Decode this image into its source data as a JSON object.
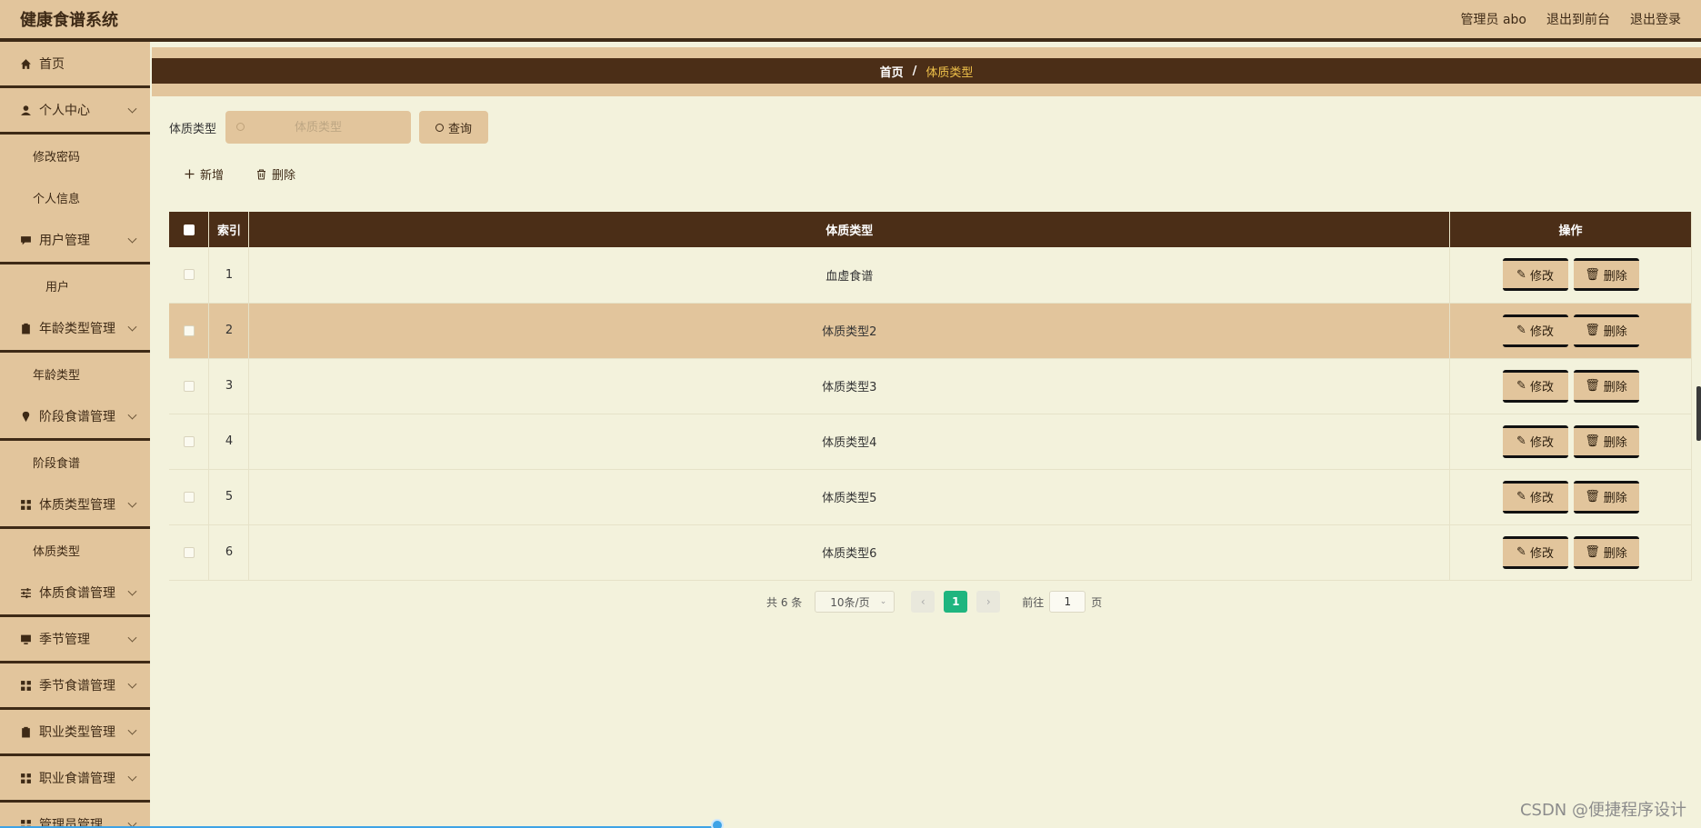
{
  "header": {
    "title": "健康食谱系统",
    "user": "管理员 abo",
    "front": "退出到前台",
    "logout": "退出登录"
  },
  "sidebar": {
    "items": [
      {
        "label": "首页",
        "icon": "home-icon"
      },
      {
        "label": "个人中心",
        "icon": "user-icon"
      },
      {
        "label": "修改密码"
      },
      {
        "label": "个人信息"
      },
      {
        "label": "用户管理",
        "icon": "chat-icon"
      },
      {
        "label": "用户"
      },
      {
        "label": "年龄类型管理",
        "icon": "clipboard-icon"
      },
      {
        "label": "年龄类型"
      },
      {
        "label": "阶段食谱管理",
        "icon": "pin-icon"
      },
      {
        "label": "阶段食谱"
      },
      {
        "label": "体质类型管理",
        "icon": "grid-icon"
      },
      {
        "label": "体质类型"
      },
      {
        "label": "体质食谱管理",
        "icon": "sliders-icon"
      },
      {
        "label": "季节管理",
        "icon": "monitor-icon"
      },
      {
        "label": "季节食谱管理",
        "icon": "grid-icon"
      },
      {
        "label": "职业类型管理",
        "icon": "clipboard-icon"
      },
      {
        "label": "职业食谱管理",
        "icon": "grid-icon"
      },
      {
        "label": "管理员管理",
        "icon": "grid-icon"
      }
    ]
  },
  "breadcrumb": {
    "home": "首页",
    "sep": "/",
    "current": "体质类型"
  },
  "search": {
    "label": "体质类型",
    "placeholder": "体质类型",
    "button": "查询"
  },
  "toolbar": {
    "add": "新增",
    "delete": "删除"
  },
  "table": {
    "headers": [
      "索引",
      "体质类型",
      "操作"
    ],
    "rows": [
      {
        "index": "1",
        "type": "血虚食谱"
      },
      {
        "index": "2",
        "type": "体质类型2"
      },
      {
        "index": "3",
        "type": "体质类型3"
      },
      {
        "index": "4",
        "type": "体质类型4"
      },
      {
        "index": "5",
        "type": "体质类型5"
      },
      {
        "index": "6",
        "type": "体质类型6"
      }
    ],
    "edit_label": "修改",
    "delete_label": "删除"
  },
  "pagination": {
    "total": "共 6 条",
    "page_size": "10条/页",
    "current_page": "1",
    "goto_prefix": "前往",
    "goto_value": "1",
    "goto_suffix": "页"
  },
  "watermark": "CSDN @便捷程序设计",
  "colors": {
    "accent": "#e2c59c",
    "dark": "#4b2e17",
    "background": "#f3f2dc",
    "active_page": "#1fb57f",
    "breadcrumb_current": "#f0c24a"
  }
}
